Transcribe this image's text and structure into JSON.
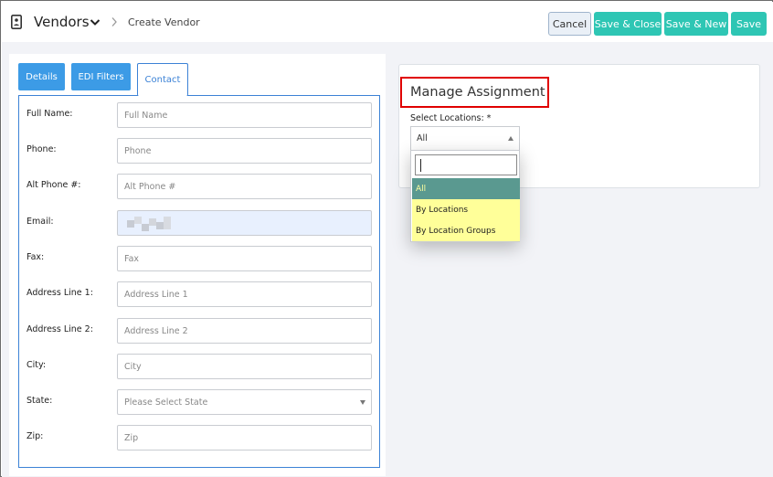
{
  "header": {
    "title": "Vendors",
    "breadcrumb": "Create Vendor",
    "buttons": {
      "cancel": "Cancel",
      "save_close": "Save & Close",
      "save_new": "Save & New",
      "save": "Save"
    }
  },
  "tabs": [
    {
      "label": "Details"
    },
    {
      "label": "EDI Filters"
    },
    {
      "label": "Contact"
    }
  ],
  "form": {
    "full_name": {
      "label": "Full Name:",
      "placeholder": "Full Name"
    },
    "phone": {
      "label": "Phone:",
      "placeholder": "Phone"
    },
    "alt_phone": {
      "label": "Alt Phone #:",
      "placeholder": "Alt Phone #"
    },
    "email": {
      "label": "Email:"
    },
    "fax": {
      "label": "Fax:",
      "placeholder": "Fax"
    },
    "address1": {
      "label": "Address Line 1:",
      "placeholder": "Address Line 1"
    },
    "address2": {
      "label": "Address Line 2:",
      "placeholder": "Address Line 2"
    },
    "city": {
      "label": "City:",
      "placeholder": "City"
    },
    "state": {
      "label": "State:",
      "placeholder": "Please Select State"
    },
    "zip": {
      "label": "Zip:",
      "placeholder": "Zip"
    }
  },
  "assignment": {
    "title": "Manage Assignment",
    "select_label": "Select Locations: *",
    "selected": "All",
    "options": [
      "All",
      "By Locations",
      "By Location Groups"
    ]
  },
  "colors": {
    "accent_teal": "#2ec6b4",
    "tab_blue": "#3c9be6",
    "highlight_red": "#e00000",
    "dropdown_yellow": "#ffff99",
    "dropdown_active": "#5a9990"
  },
  "icons": {
    "vendor": "contact-card-icon",
    "dropdown": "chevron-down-icon",
    "breadcrumb": "chevron-right-icon"
  }
}
